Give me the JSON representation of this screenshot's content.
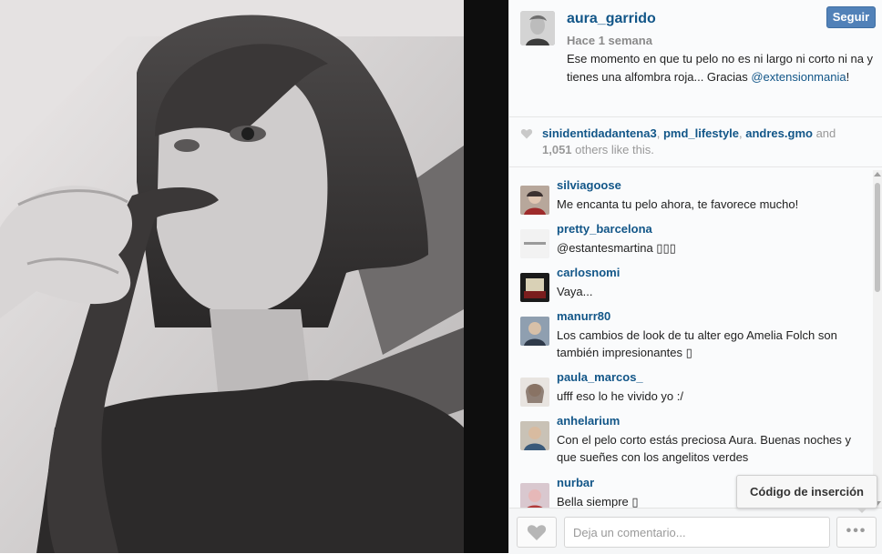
{
  "post": {
    "author": "aura_garrido",
    "follow_label": "Seguir",
    "time": "Hace 1 semana",
    "caption_text": "Ese momento en que tu pelo no es ni largo ni corto ni na y tienes una alfombra roja... Gracias ",
    "caption_mention": "@extensionmania",
    "caption_end": "!"
  },
  "likes": {
    "users": [
      "sinidentidadantena3",
      "pmd_lifestyle",
      "andres.gmo"
    ],
    "sep1": ", ",
    "sep2": ", ",
    "and_text": " and ",
    "count": "1,051",
    "suffix": " others like this."
  },
  "comments": [
    {
      "user": "silviagoose",
      "text": "Me encanta tu pelo ahora, te favorece mucho!"
    },
    {
      "user": "pretty_barcelona",
      "text": "@estantesmartina ▯▯▯"
    },
    {
      "user": "carlosnomi",
      "text": "Vaya..."
    },
    {
      "user": "manurr80",
      "text": "Los cambios de look de tu alter ego Amelia Folch son también impresionantes ▯"
    },
    {
      "user": "paula_marcos_",
      "text": "ufff eso lo he vivido yo :/"
    },
    {
      "user": "anhelarium",
      "text": "Con el pelo corto estás preciosa Aura. Buenas noches y que sueñes con los angelitos verdes"
    },
    {
      "user": "nurbar",
      "text": "Bella siempre ▯"
    }
  ],
  "footer": {
    "comment_placeholder": "Deja un comentario...",
    "more_label": "•••",
    "tooltip": "Código de inserción"
  },
  "icons": {
    "like": "heart-icon",
    "more": "ellipsis-icon"
  },
  "colors": {
    "link": "#125688",
    "follow_button": "#5181b8"
  }
}
